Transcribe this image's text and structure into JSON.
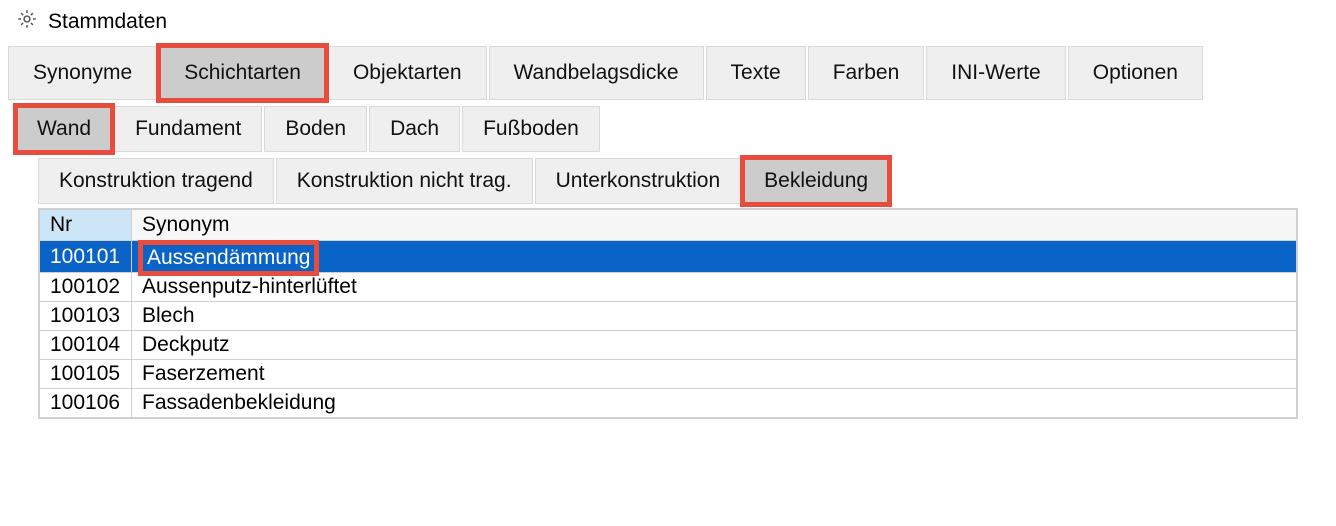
{
  "window": {
    "title": "Stammdaten"
  },
  "tabs_main": [
    {
      "id": "synonyme",
      "label": "Synonyme",
      "active": false,
      "highlight": false
    },
    {
      "id": "schichtarten",
      "label": "Schichtarten",
      "active": true,
      "highlight": true
    },
    {
      "id": "objektarten",
      "label": "Objektarten",
      "active": false,
      "highlight": false
    },
    {
      "id": "wandbelagsdicke",
      "label": "Wandbelagsdicke",
      "active": false,
      "highlight": false
    },
    {
      "id": "texte",
      "label": "Texte",
      "active": false,
      "highlight": false
    },
    {
      "id": "farben",
      "label": "Farben",
      "active": false,
      "highlight": false
    },
    {
      "id": "iniwerte",
      "label": "INI-Werte",
      "active": false,
      "highlight": false
    },
    {
      "id": "optionen",
      "label": "Optionen",
      "active": false,
      "highlight": false
    }
  ],
  "tabs_sub": [
    {
      "id": "wand",
      "label": "Wand",
      "active": true,
      "highlight": true
    },
    {
      "id": "fundament",
      "label": "Fundament",
      "active": false,
      "highlight": false
    },
    {
      "id": "boden",
      "label": "Boden",
      "active": false,
      "highlight": false
    },
    {
      "id": "dach",
      "label": "Dach",
      "active": false,
      "highlight": false
    },
    {
      "id": "fussboden",
      "label": "Fußboden",
      "active": false,
      "highlight": false
    }
  ],
  "tabs_sub2": [
    {
      "id": "konstr-tragend",
      "label": "Konstruktion tragend",
      "active": false,
      "highlight": false
    },
    {
      "id": "konstr-nicht-trag",
      "label": "Konstruktion nicht trag.",
      "active": false,
      "highlight": false
    },
    {
      "id": "unterkonstruktion",
      "label": "Unterkonstruktion",
      "active": false,
      "highlight": false
    },
    {
      "id": "bekleidung",
      "label": "Bekleidung",
      "active": true,
      "highlight": true
    }
  ],
  "table": {
    "columns": {
      "nr": "Nr",
      "synonym": "Synonym"
    },
    "rows": [
      {
        "nr": "100101",
        "synonym": "Aussendämmung",
        "selected": true,
        "highlight": true
      },
      {
        "nr": "100102",
        "synonym": "Aussenputz-hinterlüftet",
        "selected": false,
        "highlight": false
      },
      {
        "nr": "100103",
        "synonym": "Blech",
        "selected": false,
        "highlight": false
      },
      {
        "nr": "100104",
        "synonym": "Deckputz",
        "selected": false,
        "highlight": false
      },
      {
        "nr": "100105",
        "synonym": "Faserzement",
        "selected": false,
        "highlight": false
      },
      {
        "nr": "100106",
        "synonym": "Fassadenbekleidung",
        "selected": false,
        "highlight": false
      }
    ]
  }
}
